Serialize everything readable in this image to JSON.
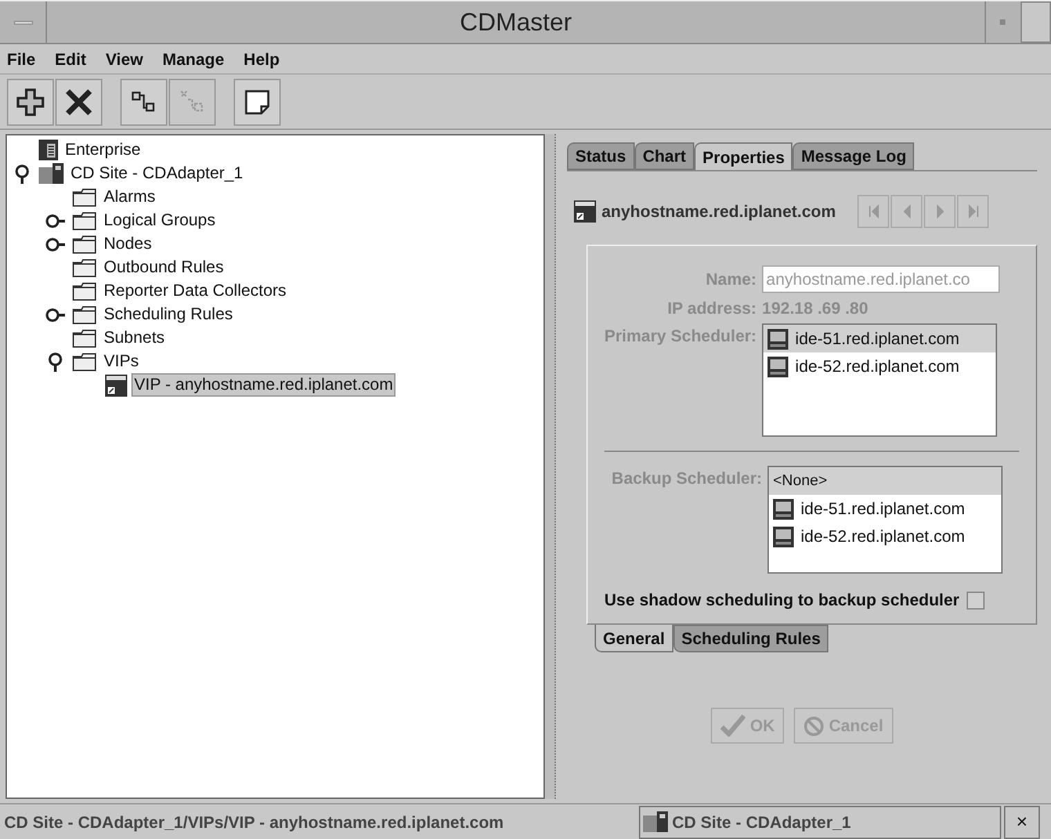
{
  "window": {
    "title": "CDMaster"
  },
  "menu": [
    {
      "label": "File"
    },
    {
      "label": "Edit"
    },
    {
      "label": "View"
    },
    {
      "label": "Manage"
    },
    {
      "label": "Help"
    }
  ],
  "toolbar": [
    {
      "kind": "add",
      "disabled": false
    },
    {
      "kind": "delete",
      "disabled": false
    },
    {
      "kind": "connect",
      "disabled": false
    },
    {
      "kind": "disconnect",
      "disabled": true
    },
    {
      "kind": "note",
      "disabled": false
    }
  ],
  "tree": [
    {
      "label": "Enterprise",
      "kind": "enterprise",
      "selected": false
    },
    {
      "label": "CD Site - CDAdapter_1",
      "kind": "site",
      "selected": false,
      "expanded": true,
      "children": [
        {
          "label": "Alarms",
          "kind": "folder",
          "selected": false
        },
        {
          "label": "Logical Groups",
          "kind": "folder",
          "selected": false,
          "expanded": false
        },
        {
          "label": "Nodes",
          "kind": "folder",
          "selected": false,
          "expanded": false
        },
        {
          "label": "Outbound Rules",
          "kind": "folder",
          "selected": false
        },
        {
          "label": "Reporter Data Collectors",
          "kind": "folder",
          "selected": false
        },
        {
          "label": "Scheduling Rules",
          "kind": "folder",
          "selected": false,
          "expanded": false
        },
        {
          "label": "Subnets",
          "kind": "folder",
          "selected": false
        },
        {
          "label": "VIPs",
          "kind": "folder",
          "selected": false,
          "expanded": true,
          "children": [
            {
              "label": "VIP - anyhostname.red.iplanet.com",
              "kind": "vip",
              "selected": true
            }
          ]
        }
      ]
    }
  ],
  "tabs": [
    {
      "label": "Status",
      "selected": false
    },
    {
      "label": "Chart",
      "selected": false
    },
    {
      "label": "Properties",
      "selected": true
    },
    {
      "label": "Message Log",
      "selected": false
    }
  ],
  "header": {
    "title": "anyhostname.red.iplanet.com"
  },
  "nav_buttons": [
    {
      "kind": "first",
      "disabled": true
    },
    {
      "kind": "prev",
      "disabled": true
    },
    {
      "kind": "next",
      "disabled": true
    },
    {
      "kind": "last",
      "disabled": true
    }
  ],
  "form": {
    "disabled": true,
    "name": {
      "label": "Name:",
      "value": "anyhostname.red.iplanet.co"
    },
    "ip": {
      "label": "IP address:",
      "value": "192.18 .69 .80"
    },
    "primary": {
      "label": "Primary Scheduler:",
      "items": [
        {
          "label": "ide-51.red.iplanet.com",
          "kind": "host",
          "selected": true
        },
        {
          "label": "ide-52.red.iplanet.com",
          "kind": "host",
          "selected": false
        }
      ]
    },
    "backup": {
      "label": "Backup Scheduler:",
      "items": [
        {
          "label": "<None>",
          "kind": "none",
          "selected": true
        },
        {
          "label": "ide-51.red.iplanet.com",
          "kind": "host",
          "selected": false
        },
        {
          "label": "ide-52.red.iplanet.com",
          "kind": "host",
          "selected": false
        }
      ]
    },
    "shadow": {
      "label": "Use shadow scheduling to backup scheduler",
      "checked": false
    }
  },
  "subtabs": [
    {
      "label": "General",
      "selected": true
    },
    {
      "label": "Scheduling Rules",
      "selected": false
    }
  ],
  "buttons": [
    {
      "label": "OK",
      "kind": "ok",
      "disabled": true
    },
    {
      "label": "Cancel",
      "kind": "cancel",
      "disabled": true
    }
  ],
  "status_bar": {
    "path": "CD Site - CDAdapter_1/VIPs/VIP - anyhostname.red.iplanet.com",
    "site_tab": "CD Site - CDAdapter_1",
    "close": "×"
  }
}
